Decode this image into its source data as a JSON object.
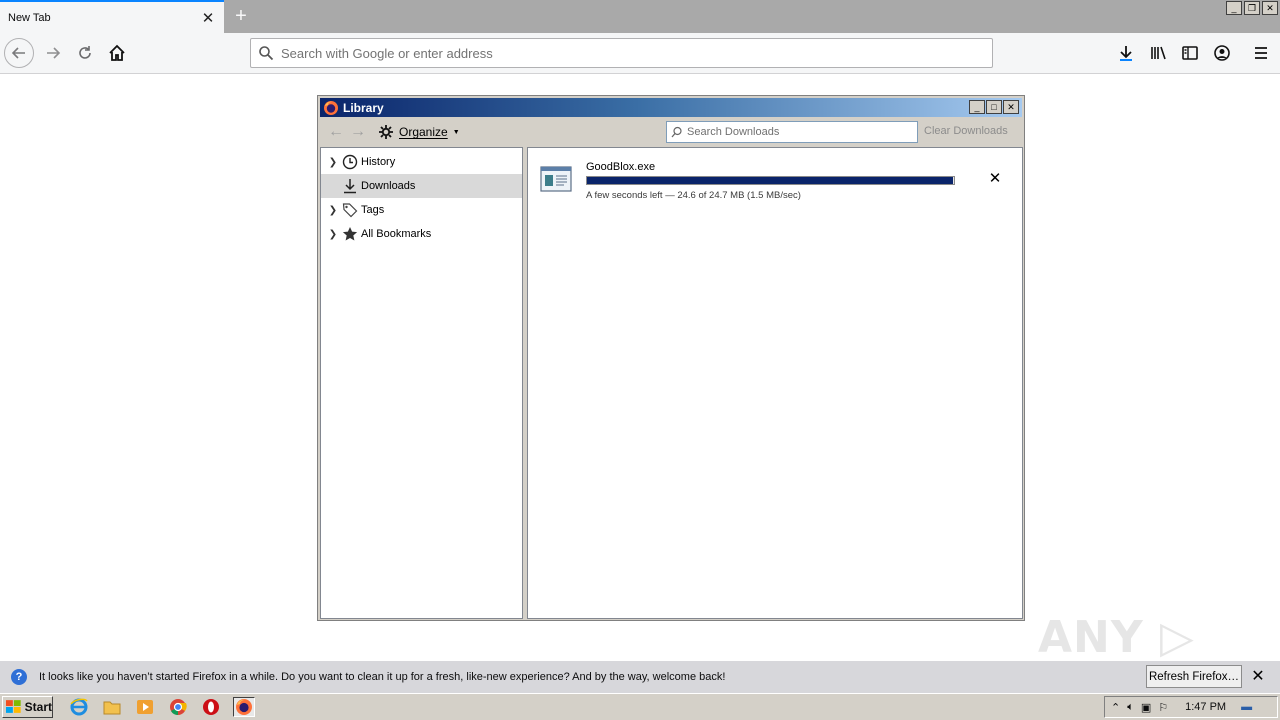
{
  "browser": {
    "tab_title": "New Tab",
    "url_placeholder": "Search with Google or enter address"
  },
  "library": {
    "window_title": "Library",
    "organize_label": "Organize",
    "search_placeholder": "Search Downloads",
    "clear_downloads_label": "Clear Downloads",
    "sidebar_items": [
      {
        "label": "History",
        "icon": "history-clock-icon",
        "expandable": true
      },
      {
        "label": "Downloads",
        "icon": "download-arrow-icon",
        "expandable": false,
        "selected": true
      },
      {
        "label": "Tags",
        "icon": "tag-icon",
        "expandable": true
      },
      {
        "label": "All Bookmarks",
        "icon": "star-icon",
        "expandable": true
      }
    ],
    "download": {
      "filename": "GoodBlox.exe",
      "status": "A few seconds left — 24.6 of 24.7 MB (1.5 MB/sec)",
      "progress_fraction": 0.996
    }
  },
  "notification": {
    "message": "It looks like you haven’t started Firefox in a while. Do you want to clean it up for a fresh, like-new experience? And by the way, welcome back!",
    "button_label": "Refresh Firefox…"
  },
  "taskbar": {
    "start_label": "Start",
    "clock": "1:47 PM"
  },
  "watermark": "ANY RUN",
  "colors": {
    "accent": "#0a84ff",
    "title_bar_start": "#0a246a",
    "progress_fill": "#0a246a"
  }
}
